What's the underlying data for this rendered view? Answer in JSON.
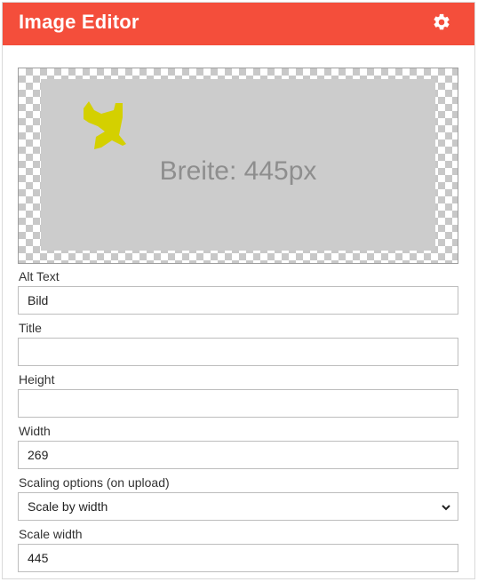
{
  "header": {
    "title": "Image Editor",
    "settings_icon": "gear-icon",
    "background_color": "#f44e3b"
  },
  "preview": {
    "placeholder_text": "Breite: 445px",
    "shape_color": "#d4d000"
  },
  "form": {
    "alt_text": {
      "label": "Alt Text",
      "value": "Bild"
    },
    "title": {
      "label": "Title",
      "value": ""
    },
    "height": {
      "label": "Height",
      "value": ""
    },
    "width": {
      "label": "Width",
      "value": "269"
    },
    "scaling": {
      "label": "Scaling options (on upload)",
      "selected": "Scale by width"
    },
    "scale_width": {
      "label": "Scale width",
      "value": "445"
    }
  }
}
